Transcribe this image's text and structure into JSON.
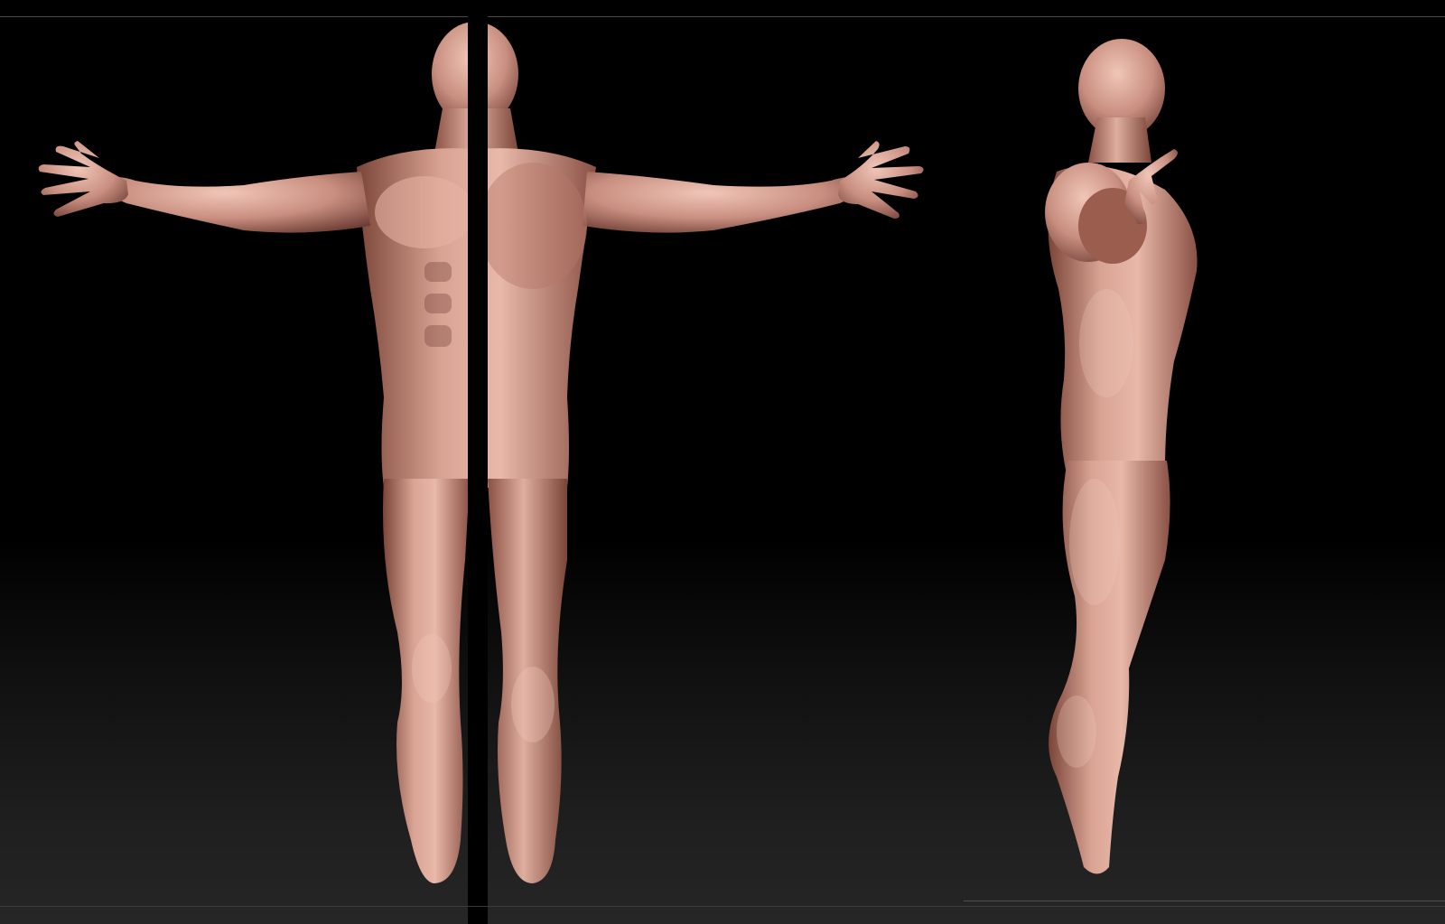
{
  "scene": {
    "skin_color": "#c98f80",
    "skin_highlight": "#f0c6b8",
    "skin_shadow": "#6e3d34",
    "background_top": "#000000",
    "background_bottom": "#262626"
  }
}
